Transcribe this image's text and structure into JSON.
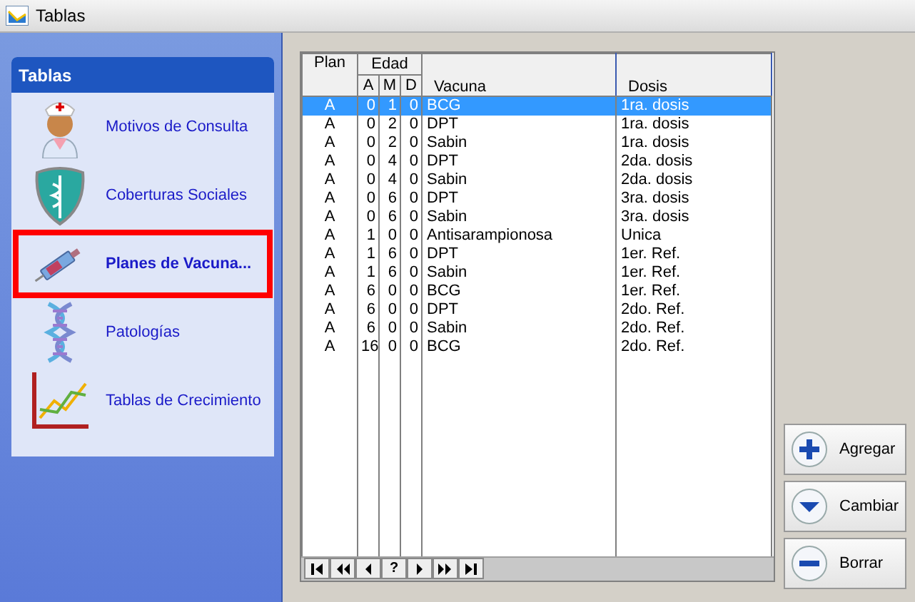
{
  "window": {
    "title": "Tablas"
  },
  "sidebar": {
    "title": "Tablas",
    "items": [
      {
        "label": "Motivos de Consulta",
        "kind": "nurse",
        "selected": false
      },
      {
        "label": "Coberturas Sociales",
        "kind": "shield",
        "selected": false
      },
      {
        "label": "Planes de Vacuna...",
        "kind": "syringe",
        "selected": true
      },
      {
        "label": "Patologías",
        "kind": "dna",
        "selected": false
      },
      {
        "label": "Tablas de Crecimiento",
        "kind": "chart",
        "selected": false
      }
    ]
  },
  "table": {
    "columns": {
      "plan": "Plan",
      "edad": "Edad",
      "a": "A",
      "m": "M",
      "d": "D",
      "vacuna": "Vacuna",
      "dosis": "Dosis"
    },
    "rows": [
      {
        "plan": "A",
        "a": "0",
        "m": "1",
        "d": "0",
        "vacuna": "BCG",
        "dosis": "1ra. dosis",
        "selected": true
      },
      {
        "plan": "A",
        "a": "0",
        "m": "2",
        "d": "0",
        "vacuna": "DPT",
        "dosis": "1ra. dosis",
        "selected": false
      },
      {
        "plan": "A",
        "a": "0",
        "m": "2",
        "d": "0",
        "vacuna": "Sabin",
        "dosis": "1ra. dosis",
        "selected": false
      },
      {
        "plan": "A",
        "a": "0",
        "m": "4",
        "d": "0",
        "vacuna": "DPT",
        "dosis": "2da. dosis",
        "selected": false
      },
      {
        "plan": "A",
        "a": "0",
        "m": "4",
        "d": "0",
        "vacuna": "Sabin",
        "dosis": "2da. dosis",
        "selected": false
      },
      {
        "plan": "A",
        "a": "0",
        "m": "6",
        "d": "0",
        "vacuna": "DPT",
        "dosis": "3ra. dosis",
        "selected": false
      },
      {
        "plan": "A",
        "a": "0",
        "m": "6",
        "d": "0",
        "vacuna": "Sabin",
        "dosis": "3ra. dosis",
        "selected": false
      },
      {
        "plan": "A",
        "a": "1",
        "m": "0",
        "d": "0",
        "vacuna": "Antisarampionosa",
        "dosis": "Unica",
        "selected": false
      },
      {
        "plan": "A",
        "a": "1",
        "m": "6",
        "d": "0",
        "vacuna": "DPT",
        "dosis": "1er. Ref.",
        "selected": false
      },
      {
        "plan": "A",
        "a": "1",
        "m": "6",
        "d": "0",
        "vacuna": "Sabin",
        "dosis": "1er. Ref.",
        "selected": false
      },
      {
        "plan": "A",
        "a": "6",
        "m": "0",
        "d": "0",
        "vacuna": "BCG",
        "dosis": "1er. Ref.",
        "selected": false
      },
      {
        "plan": "A",
        "a": "6",
        "m": "0",
        "d": "0",
        "vacuna": "DPT",
        "dosis": "2do. Ref.",
        "selected": false
      },
      {
        "plan": "A",
        "a": "6",
        "m": "0",
        "d": "0",
        "vacuna": "Sabin",
        "dosis": "2do. Ref.",
        "selected": false
      },
      {
        "plan": "A",
        "a": "16",
        "m": "0",
        "d": "0",
        "vacuna": "BCG",
        "dosis": "2do. Ref.",
        "selected": false
      }
    ]
  },
  "navigator": [
    {
      "kind": "first"
    },
    {
      "kind": "prev-page"
    },
    {
      "kind": "prev"
    },
    {
      "kind": "text",
      "label": "?"
    },
    {
      "kind": "next"
    },
    {
      "kind": "next-page"
    },
    {
      "kind": "last"
    }
  ],
  "buttons": [
    {
      "label": "Agregar",
      "kind": "add"
    },
    {
      "label": "Cambiar",
      "kind": "change"
    },
    {
      "label": "Borrar",
      "kind": "delete"
    }
  ]
}
